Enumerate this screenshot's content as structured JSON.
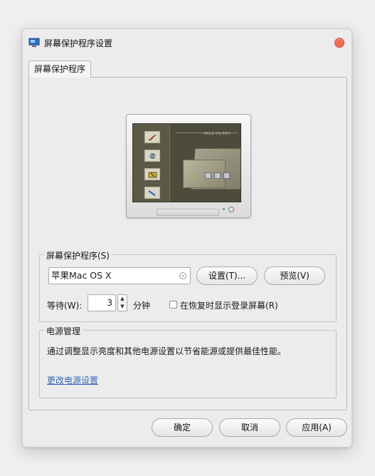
{
  "window": {
    "title": "屏幕保护程序设置",
    "app_icon": "display-settings-icon",
    "close_icon": "close-icon",
    "close_color": "#ee6e55"
  },
  "tabs": [
    {
      "label": "屏幕保护程序",
      "active": true
    }
  ],
  "preview": {
    "screen_text": "-MILK-VS-PRY-",
    "monitor_icon": "monitor-icon"
  },
  "screensaver": {
    "group_label": "屏幕保护程序(S)",
    "selected": "苹果Mac OS X",
    "settings_button": "设置(T)...",
    "preview_button": "预览(V)",
    "wait_label": "等待(W):",
    "wait_value": "3",
    "wait_unit": "分钟",
    "resume_checkbox_label": "在恢复时显示登录屏幕(R)",
    "resume_checked": false
  },
  "power": {
    "group_label": "电源管理",
    "description": "通过调整显示亮度和其他电源设置以节省能源或提供最佳性能。",
    "link": "更改电源设置",
    "link_color": "#3767b5"
  },
  "footer": {
    "ok": "确定",
    "cancel": "取消",
    "apply": "应用(A)"
  }
}
